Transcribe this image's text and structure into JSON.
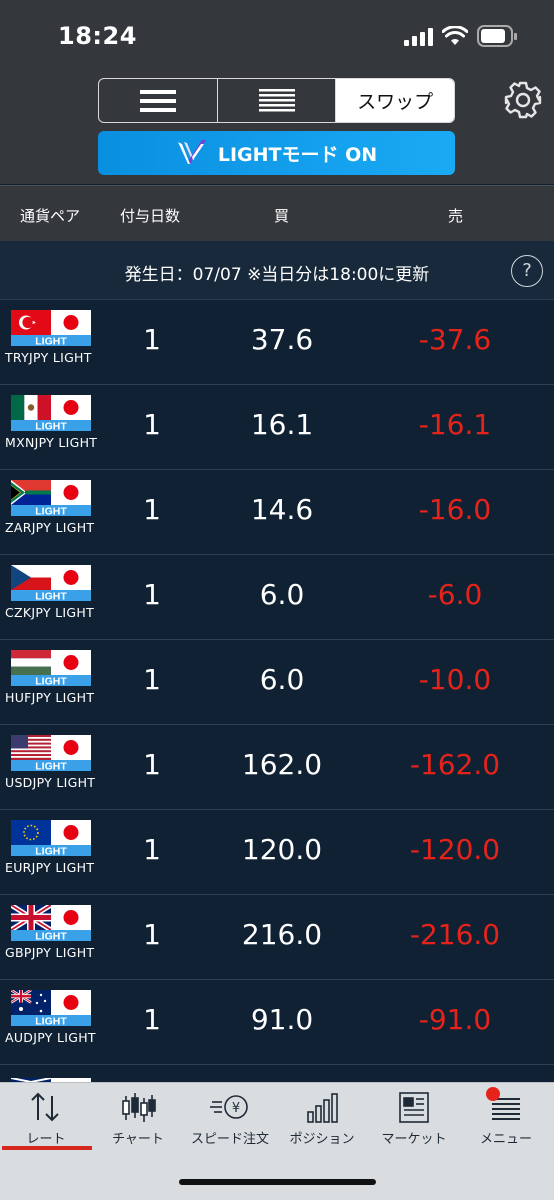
{
  "status_bar": {
    "time": "18:24"
  },
  "header": {
    "segments": [
      {
        "icon": "list-compact-icon"
      },
      {
        "icon": "list-dense-icon"
      },
      {
        "label": "スワップ",
        "active": true
      }
    ],
    "settings_icon": "gear-icon",
    "light_mode_label": "LIGHTモード ON"
  },
  "columns": {
    "pair": "通貨ペア",
    "days": "付与日数",
    "buy": "買",
    "sell": "売"
  },
  "info": {
    "date_text": "発生日：07/07 ※当日分は18:00に更新",
    "help": "?"
  },
  "flag_badge": "LIGHT",
  "rows": [
    {
      "pair": "TRYJPY LIGHT",
      "days": "1",
      "buy": "37.6",
      "sell": "-37.6"
    },
    {
      "pair": "MXNJPY LIGHT",
      "days": "1",
      "buy": "16.1",
      "sell": "-16.1"
    },
    {
      "pair": "ZARJPY LIGHT",
      "days": "1",
      "buy": "14.6",
      "sell": "-16.0"
    },
    {
      "pair": "CZKJPY LIGHT",
      "days": "1",
      "buy": "6.0",
      "sell": "-6.0"
    },
    {
      "pair": "HUFJPY LIGHT",
      "days": "1",
      "buy": "6.0",
      "sell": "-10.0"
    },
    {
      "pair": "USDJPY LIGHT",
      "days": "1",
      "buy": "162.0",
      "sell": "-162.0"
    },
    {
      "pair": "EURJPY LIGHT",
      "days": "1",
      "buy": "120.0",
      "sell": "-120.0"
    },
    {
      "pair": "GBPJPY LIGHT",
      "days": "1",
      "buy": "216.0",
      "sell": "-216.0"
    },
    {
      "pair": "AUDJPY LIGHT",
      "days": "1",
      "buy": "91.0",
      "sell": "-91.0"
    }
  ],
  "nav": [
    {
      "label": "レート",
      "icon": "rate-arrows-icon",
      "active": true
    },
    {
      "label": "チャート",
      "icon": "candlestick-chart-icon"
    },
    {
      "label": "スピード注文",
      "icon": "speed-order-icon"
    },
    {
      "label": "ポジション",
      "icon": "position-bars-icon"
    },
    {
      "label": "マーケット",
      "icon": "market-news-icon"
    },
    {
      "label": "メニュー",
      "icon": "menu-list-icon",
      "badge": true
    }
  ],
  "colors": {
    "background": "#0f2133",
    "header": "#34383d",
    "sell": "#e5231a",
    "accent": "#1aaaf4",
    "nav_active": "#d6281e"
  }
}
